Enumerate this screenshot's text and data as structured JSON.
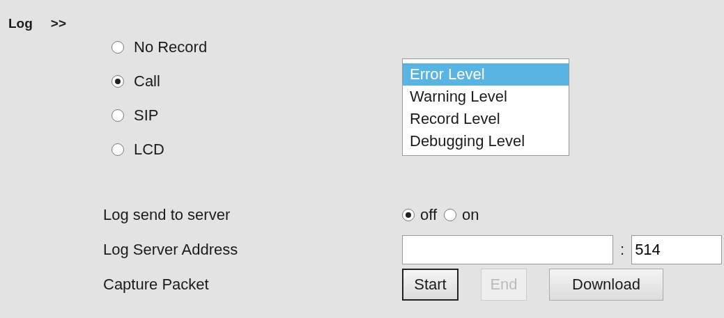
{
  "header": {
    "title": "Log",
    "toggle": ">>"
  },
  "log_types": [
    {
      "label": "No Record",
      "selected": false
    },
    {
      "label": "Call",
      "selected": true
    },
    {
      "label": "SIP",
      "selected": false
    },
    {
      "label": "LCD",
      "selected": false
    }
  ],
  "levels": [
    {
      "label": "Error Level",
      "selected": true
    },
    {
      "label": "Warning Level",
      "selected": false
    },
    {
      "label": "Record Level",
      "selected": false
    },
    {
      "label": "Debugging Level",
      "selected": false
    }
  ],
  "send_to_server": {
    "label": "Log send to server",
    "options": [
      {
        "label": "off",
        "selected": true
      },
      {
        "label": "on",
        "selected": false
      }
    ]
  },
  "server_address": {
    "label": "Log Server Address",
    "separator": ":",
    "port": "514"
  },
  "capture": {
    "label": "Capture Packet",
    "buttons": [
      {
        "label": "Start",
        "focused": true,
        "disabled": false
      },
      {
        "label": "End",
        "focused": false,
        "disabled": true
      },
      {
        "label": "Download",
        "focused": false,
        "disabled": false
      }
    ]
  }
}
